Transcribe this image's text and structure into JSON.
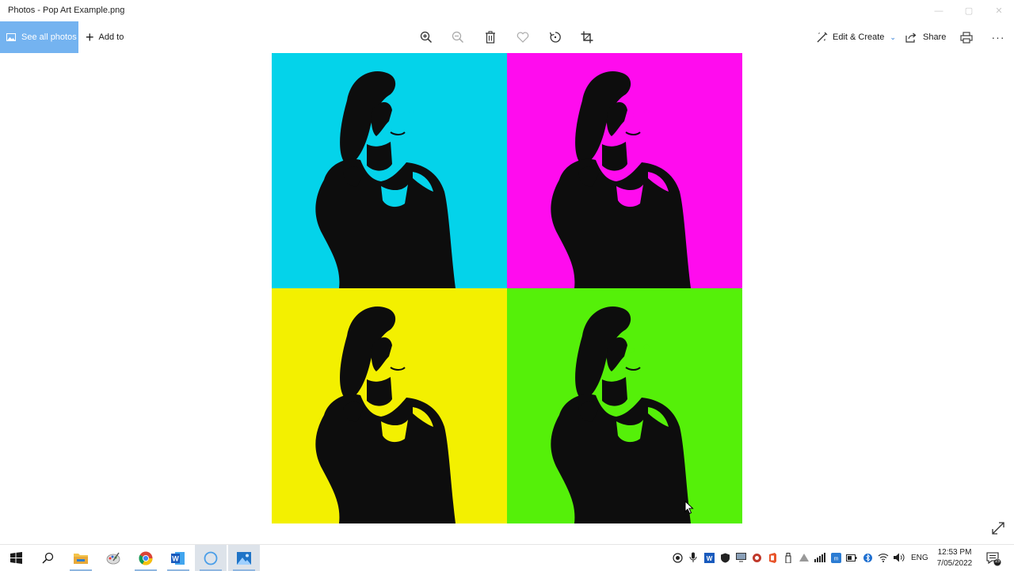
{
  "window": {
    "title": "Photos - Pop Art Example.png",
    "controls": {
      "minimize": "—",
      "maximize": "▢",
      "close": "✕"
    }
  },
  "toolbar": {
    "see_all_photos": "See all photos",
    "add_to": "Add to",
    "edit_create": "Edit & Create",
    "share": "Share",
    "more": "···",
    "icons": [
      "zoom-in-icon",
      "zoom-out-icon",
      "delete-icon",
      "favorite-icon",
      "rotate-icon",
      "crop-icon",
      "print-icon"
    ]
  },
  "image": {
    "panels": [
      {
        "position": "top-left",
        "background": "#04d3ea"
      },
      {
        "position": "top-right",
        "background": "#ff0cee"
      },
      {
        "position": "bottom-left",
        "background": "#f3f000"
      },
      {
        "position": "bottom-right",
        "background": "#55f009"
      }
    ],
    "silhouette_color": "#0d0d0d"
  },
  "taskbar": {
    "apps": [
      "start-icon",
      "search-icon",
      "file-explorer-icon",
      "paint-icon",
      "chrome-icon",
      "word-icon",
      "cortana-icon",
      "photos-icon"
    ],
    "language": "ENG",
    "time": "12:53 PM",
    "date": "7/05/2022",
    "notification_count": "15"
  },
  "colors": {
    "accent": "#74b3f0"
  }
}
